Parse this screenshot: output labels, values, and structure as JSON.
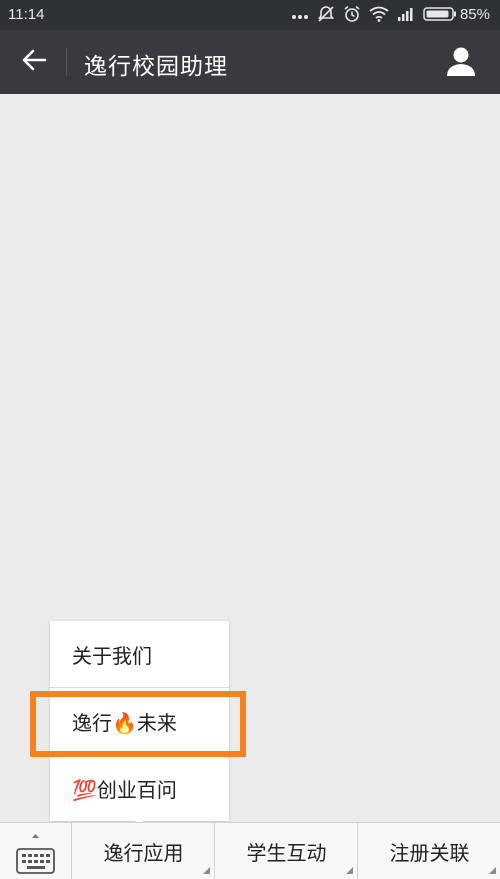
{
  "status_bar": {
    "time": "11:14",
    "battery": "85%",
    "icons": [
      "more-dots-icon",
      "silent-icon",
      "alarm-icon",
      "wifi-icon",
      "signal-icon",
      "battery-icon"
    ]
  },
  "header": {
    "title": "逸行校园助理",
    "back_icon": "back-arrow-icon",
    "profile_icon": "person-icon"
  },
  "popup_menu": {
    "items": [
      {
        "label": "关于我们"
      },
      {
        "label": "逸行🔥未来"
      },
      {
        "label": "💯创业百问"
      }
    ],
    "highlighted_index": 1,
    "highlight_color": "#f58220"
  },
  "menu_bar": {
    "keyboard_icon": "keyboard-icon",
    "items": [
      {
        "label": "逸行应用"
      },
      {
        "label": "学生互动"
      },
      {
        "label": "注册关联"
      }
    ]
  },
  "colors": {
    "status_bar_bg": "#2e3136",
    "header_bg": "#393a3f",
    "content_bg": "#ebebeb",
    "menu_bar_bg": "#f8f8f8"
  }
}
